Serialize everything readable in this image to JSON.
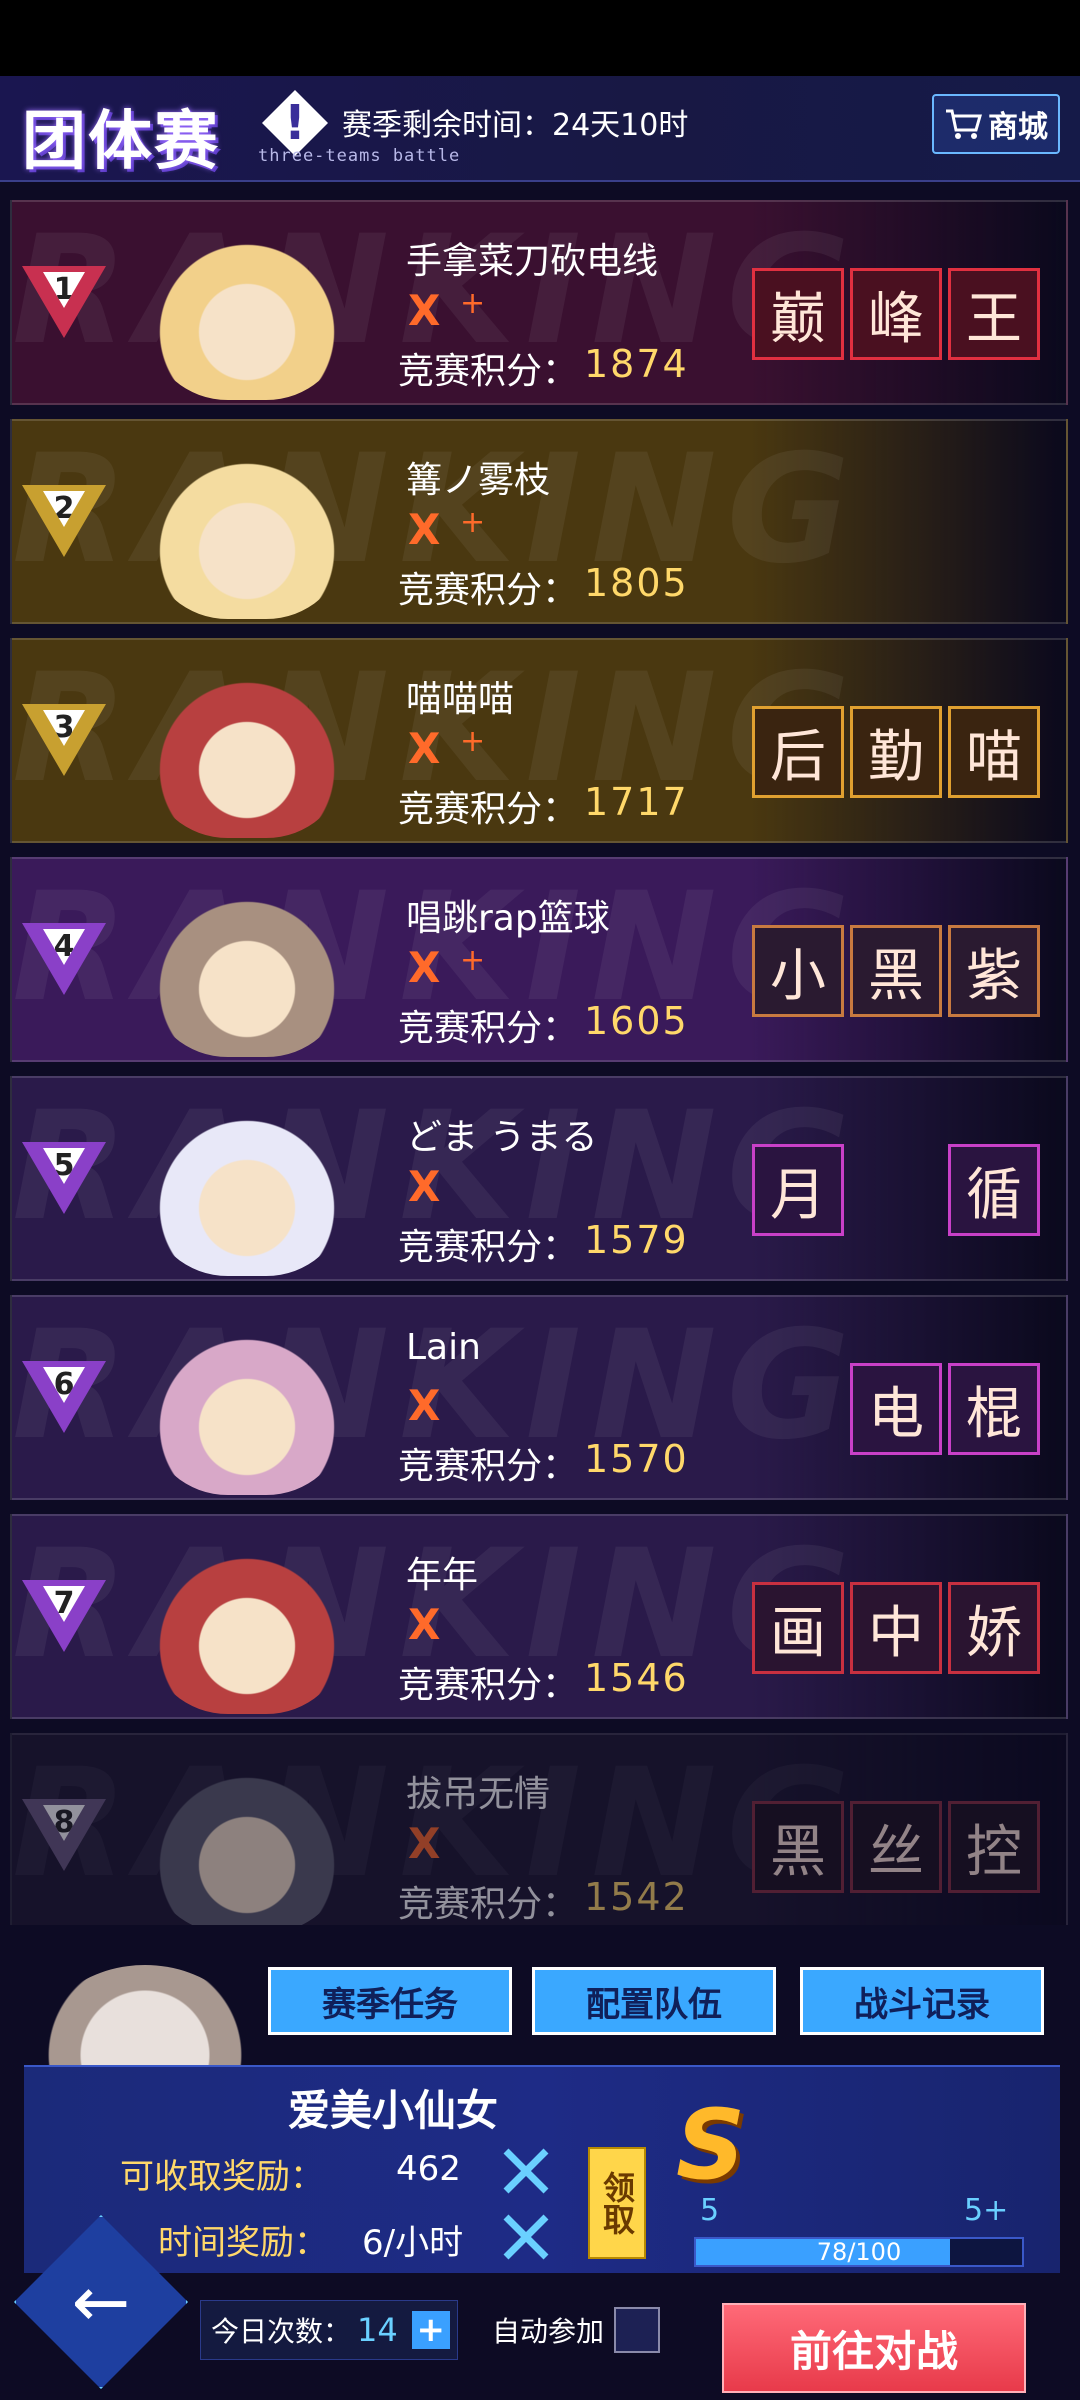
{
  "header": {
    "title": "团体赛",
    "title_icon": "!",
    "subtitle": "three-teams battle",
    "season_remaining": "赛季剩余时间：24天10时",
    "shop_label": "商城"
  },
  "ranking_watermark": "RANKING",
  "rows": [
    {
      "rank": "1",
      "name": "手拿菜刀砍电线",
      "x": "X",
      "plus": "+",
      "score_label": "竞赛积分：",
      "score": "1874",
      "title_chars": [
        "巅",
        "峰",
        "王"
      ],
      "badge_color": "#c83050",
      "bg": "#3a1030",
      "avatar_color": "#f2d08a",
      "tc_border": "#e03040",
      "tc_bg": "#4a1020"
    },
    {
      "rank": "2",
      "name": "篝ノ雾枝",
      "x": "X",
      "plus": "+",
      "score_label": "竞赛积分：",
      "score": "1805",
      "title_chars": [],
      "badge_color": "#c8a030",
      "bg": "#4a3810",
      "avatar_color": "#f4dca0",
      "tc_border": "#e0a030",
      "tc_bg": "#3a2a10"
    },
    {
      "rank": "3",
      "name": "喵喵喵",
      "x": "X",
      "plus": "+",
      "score_label": "竞赛积分：",
      "score": "1717",
      "title_chars": [
        "后",
        "勤",
        "喵"
      ],
      "badge_color": "#c8a030",
      "bg": "#4a3810",
      "avatar_color": "#b84040",
      "tc_border": "#e0a030",
      "tc_bg": "#3a2410"
    },
    {
      "rank": "4",
      "name": "唱跳rap篮球",
      "x": "X",
      "plus": "+",
      "score_label": "竞赛积分：",
      "score": "1605",
      "title_chars": [
        "小",
        "黑",
        "紫"
      ],
      "badge_color": "#8a40c8",
      "bg": "#3a1a5a",
      "avatar_color": "#a89080",
      "tc_border": "#c87a40",
      "tc_bg": "#2a1a30"
    },
    {
      "rank": "5",
      "name": "どま うまる",
      "x": "X",
      "plus": "",
      "score_label": "竞赛积分：",
      "score": "1579",
      "title_chars": [
        "月",
        "",
        "循"
      ],
      "badge_color": "#8a40c8",
      "bg": "#2a1a4a",
      "avatar_color": "#e8e8f8",
      "tc_border": "#c840c8",
      "tc_bg": "#2a1440"
    },
    {
      "rank": "6",
      "name": "Lain",
      "x": "X",
      "plus": "",
      "score_label": "竞赛积分：",
      "score": "1570",
      "title_chars": [
        "电",
        "棍"
      ],
      "badge_color": "#8a40c8",
      "bg": "#2a1a4a",
      "avatar_color": "#d8a8c8",
      "tc_border": "#c840c8",
      "tc_bg": "#2a1440"
    },
    {
      "rank": "7",
      "name": "年年",
      "x": "X",
      "plus": "",
      "score_label": "竞赛积分：",
      "score": "1546",
      "title_chars": [
        "画",
        "中",
        "娇"
      ],
      "badge_color": "#8a40c8",
      "bg": "#2a1a4a",
      "avatar_color": "#b84040",
      "tc_border": "#c83040",
      "tc_bg": "#2a1430"
    },
    {
      "rank": "8",
      "name": "拔吊无情",
      "x": "X",
      "plus": "",
      "score_label": "竞赛积分：",
      "score": "1542",
      "title_chars": [
        "黑",
        "丝",
        "控"
      ],
      "badge_color": "#6a5a80",
      "bg": "#1e1830",
      "avatar_color": "#606070",
      "tc_border": "#8a3040",
      "tc_bg": "#1e1420"
    }
  ],
  "bottom": {
    "tabs": [
      "赛季任务",
      "配置队伍",
      "战斗记录"
    ],
    "player_name": "爱美小仙女",
    "claimable_label": "可收取奖励：",
    "claimable_value": "462",
    "time_reward_label": "时间奖励：",
    "time_reward_value": "6/小时",
    "claim_label": "领取",
    "rank_letter": "S",
    "level_current": "5",
    "level_next": "5+",
    "progress_text": "78/100",
    "progress_ratio": 0.78,
    "today_label": "今日次数：",
    "today_count": "14",
    "today_plus": "+",
    "auto_join_label": "自动参加",
    "goto_battle_label": "前往对战",
    "back_glyph": "←"
  }
}
